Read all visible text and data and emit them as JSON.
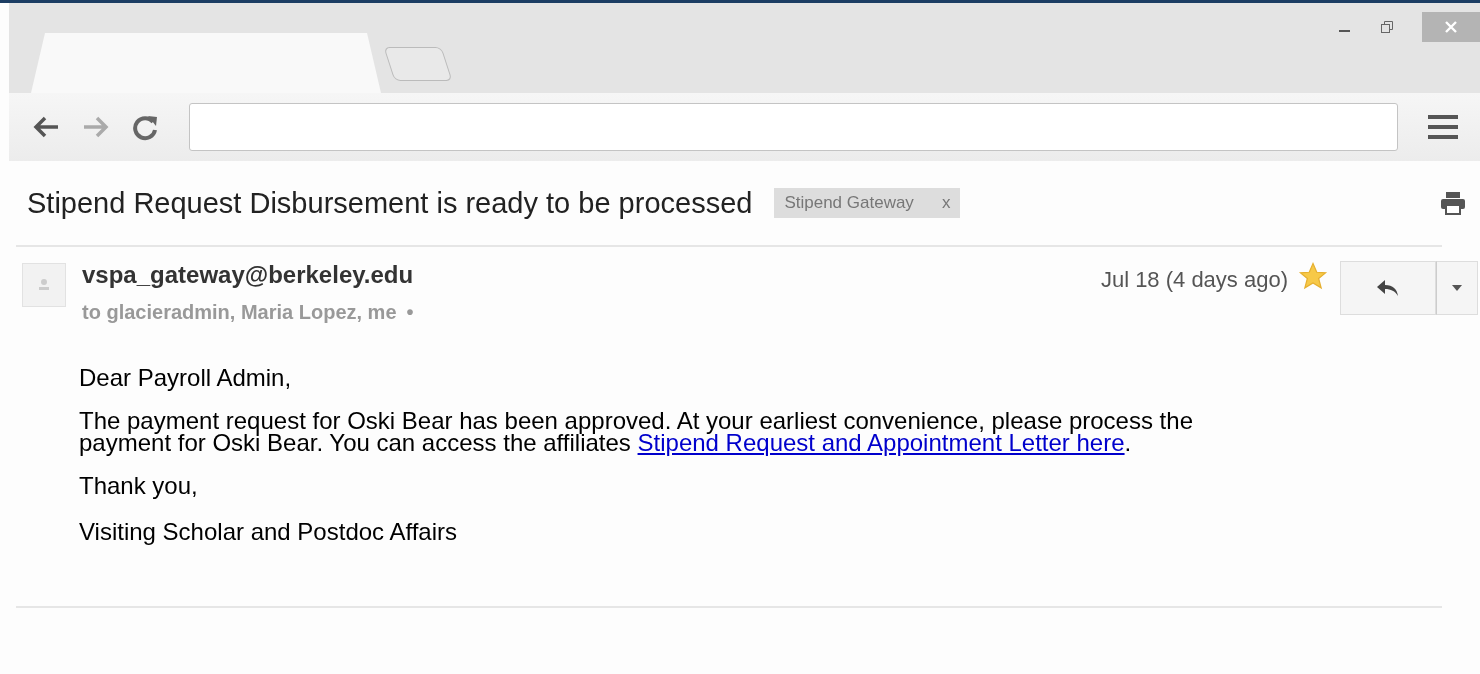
{
  "browser": {
    "tabs": [
      {
        "kind": "tab",
        "selected": true
      },
      {
        "kind": "new-tab",
        "selected": false
      }
    ]
  },
  "email": {
    "subject": "Stipend Request Disbursement is ready to be processed",
    "label": {
      "text": "Stipend Gateway",
      "remove": "x"
    },
    "sender": "vspa_gateway@berkeley.edu",
    "recipients": "to glacieradmin, Maria Lopez, me",
    "details_mark": "•",
    "date": "Jul 18 (4 days ago)",
    "starred": true,
    "body": [
      {
        "kind": "text",
        "text": "Dear Payroll Admin,"
      },
      {
        "kind": "link-paragraph",
        "text": "The payment request for Oski Bear has been approved. At your earliest convenience, please process the payment for Oski Bear. You can access the affiliates ",
        "link": "Stipend Request and Appointment Letter here",
        "after": "."
      },
      {
        "kind": "text",
        "text": "Thank you,"
      },
      {
        "kind": "text",
        "text": "Visiting Scholar and Postdoc Affairs"
      }
    ]
  }
}
